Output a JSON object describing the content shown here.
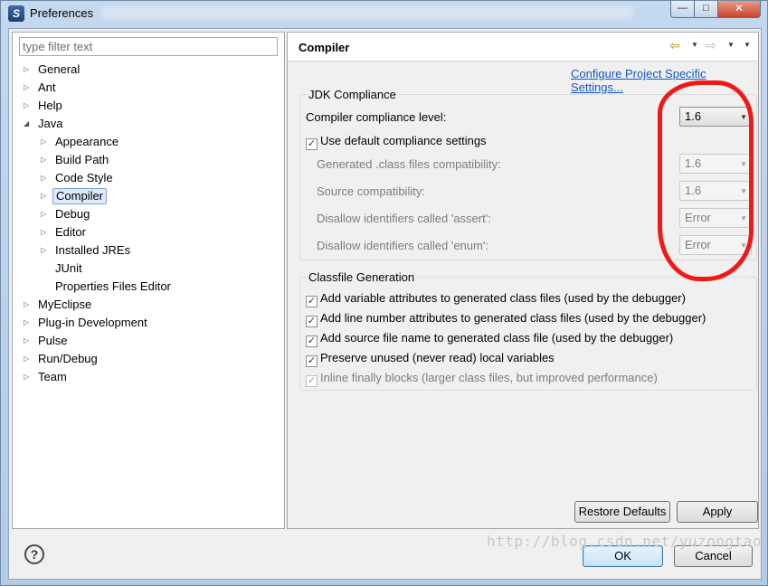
{
  "window": {
    "title": "Preferences",
    "controls": {
      "minimize": "—",
      "maximize": "□",
      "close": "✕"
    }
  },
  "filter": {
    "placeholder": "type filter text",
    "value": ""
  },
  "tree": [
    {
      "label": "General",
      "level": 0,
      "arrow": "▷"
    },
    {
      "label": "Ant",
      "level": 0,
      "arrow": "▷"
    },
    {
      "label": "Help",
      "level": 0,
      "arrow": "▷"
    },
    {
      "label": "Java",
      "level": 0,
      "arrow": "◢"
    },
    {
      "label": "Appearance",
      "level": 1,
      "arrow": "▷"
    },
    {
      "label": "Build Path",
      "level": 1,
      "arrow": "▷"
    },
    {
      "label": "Code Style",
      "level": 1,
      "arrow": "▷"
    },
    {
      "label": "Compiler",
      "level": 1,
      "arrow": "▷",
      "selected": true
    },
    {
      "label": "Debug",
      "level": 1,
      "arrow": "▷"
    },
    {
      "label": "Editor",
      "level": 1,
      "arrow": "▷"
    },
    {
      "label": "Installed JREs",
      "level": 1,
      "arrow": "▷"
    },
    {
      "label": "JUnit",
      "level": 1,
      "arrow": ""
    },
    {
      "label": "Properties Files Editor",
      "level": 1,
      "arrow": ""
    },
    {
      "label": "MyEclipse",
      "level": 0,
      "arrow": "▷"
    },
    {
      "label": "Plug-in Development",
      "level": 0,
      "arrow": "▷"
    },
    {
      "label": "Pulse",
      "level": 0,
      "arrow": "▷"
    },
    {
      "label": "Run/Debug",
      "level": 0,
      "arrow": "▷"
    },
    {
      "label": "Team",
      "level": 0,
      "arrow": "▷"
    }
  ],
  "page": {
    "title": "Compiler",
    "nav": {
      "back_icon": "⇦",
      "forward_icon": "⇨",
      "menu": "▼"
    },
    "config_link": "Configure Project Specific Settings..."
  },
  "jdk": {
    "group_title": "JDK Compliance",
    "compliance_label": "Compiler compliance level:",
    "compliance_value": "1.6",
    "use_default_label": "Use default compliance settings",
    "use_default_checked": true,
    "generated_label": "Generated .class files compatibility:",
    "generated_value": "1.6",
    "source_label": "Source compatibility:",
    "source_value": "1.6",
    "assert_label": "Disallow identifiers called 'assert':",
    "assert_value": "Error",
    "enum_label": "Disallow identifiers called 'enum':",
    "enum_value": "Error"
  },
  "classfile": {
    "group_title": "Classfile Generation",
    "options": [
      {
        "label": "Add variable attributes to generated class files (used by the debugger)",
        "checked": true,
        "enabled": true
      },
      {
        "label": "Add line number attributes to generated class files (used by the debugger)",
        "checked": true,
        "enabled": true
      },
      {
        "label": "Add source file name to generated class file (used by the debugger)",
        "checked": true,
        "enabled": true
      },
      {
        "label": "Preserve unused (never read) local variables",
        "checked": true,
        "enabled": true
      },
      {
        "label": "Inline finally blocks (larger class files, but improved performance)",
        "checked": true,
        "enabled": false
      }
    ]
  },
  "buttons": {
    "restore_defaults": "Restore Defaults",
    "apply": "Apply",
    "ok": "OK",
    "cancel": "Cancel",
    "help": "?"
  },
  "watermark": "http://blog.csdn.net/yuzongtao",
  "colors": {
    "annotation": "#f01818",
    "link": "#1155cc",
    "selection": "#dceafc"
  }
}
